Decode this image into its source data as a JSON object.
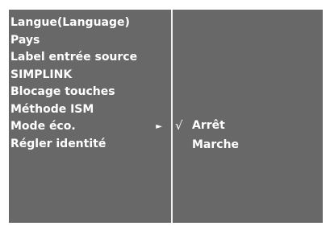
{
  "menu": {
    "items": [
      {
        "label": "Langue(Language)"
      },
      {
        "label": "Pays"
      },
      {
        "label": "Label entrée source"
      },
      {
        "label": "SIMPLINK"
      },
      {
        "label": "Blocage touches"
      },
      {
        "label": "Méthode ISM"
      },
      {
        "label": "Mode éco.",
        "selected": true,
        "arrow": "►"
      },
      {
        "label": "Régler identité"
      }
    ]
  },
  "submenu": {
    "options": [
      {
        "label": "Arrêt",
        "checked": true,
        "check_mark": "√"
      },
      {
        "label": "Marche",
        "checked": false
      }
    ]
  },
  "colors": {
    "panel": "#686868",
    "text": "#ffffff",
    "divider": "#f2f2f2"
  }
}
